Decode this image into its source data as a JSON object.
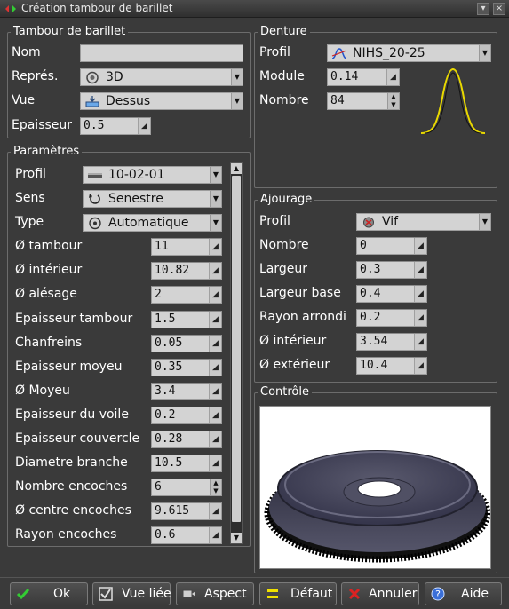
{
  "window": {
    "title": "Création tambour de barillet"
  },
  "tambour": {
    "title": "Tambour de barillet",
    "nom_label": "Nom",
    "nom_value": "",
    "repres_label": "Représ.",
    "repres_value": "3D",
    "vue_label": "Vue",
    "vue_value": "Dessus",
    "epaisseur_label": "Epaisseur",
    "epaisseur_value": "0.5"
  },
  "parametres": {
    "title": "Paramètres",
    "profil_label": "Profil",
    "profil_value": "10-02-01",
    "sens_label": "Sens",
    "sens_value": "Senestre",
    "type_label": "Type",
    "type_value": "Automatique",
    "rows": [
      {
        "label": "Ø tambour",
        "value": "11"
      },
      {
        "label": "Ø intérieur",
        "value": "10.82"
      },
      {
        "label": "Ø alésage",
        "value": "2"
      },
      {
        "label": "Epaisseur tambour",
        "value": "1.5"
      },
      {
        "label": "Chanfreins",
        "value": "0.05"
      },
      {
        "label": "Epaisseur moyeu",
        "value": "0.35"
      },
      {
        "label": "Ø Moyeu",
        "value": "3.4"
      },
      {
        "label": "Epaisseur du voile",
        "value": "0.2"
      },
      {
        "label": "Epaisseur couvercle",
        "value": "0.28"
      },
      {
        "label": "Diametre branche",
        "value": "10.5"
      },
      {
        "label": "Nombre encoches",
        "value": "6"
      },
      {
        "label": "Ø centre encoches",
        "value": "9.615"
      },
      {
        "label": "Rayon encoches",
        "value": "0.6"
      }
    ]
  },
  "denture": {
    "title": "Denture",
    "profil_label": "Profil",
    "profil_value": "NIHS_20-25",
    "module_label": "Module",
    "module_value": "0.14",
    "nombre_label": "Nombre",
    "nombre_value": "84"
  },
  "ajourage": {
    "title": "Ajourage",
    "profil_label": "Profil",
    "profil_value": "Vif",
    "rows": [
      {
        "label": "Nombre",
        "value": "0"
      },
      {
        "label": "Largeur",
        "value": "0.3"
      },
      {
        "label": "Largeur base",
        "value": "0.4"
      },
      {
        "label": "Rayon arrondi",
        "value": "0.2"
      },
      {
        "label": "Ø intérieur",
        "value": "3.54"
      },
      {
        "label": "Ø extérieur",
        "value": "10.4"
      }
    ]
  },
  "controle": {
    "title": "Contrôle"
  },
  "buttons": {
    "ok": "Ok",
    "vue_liee": "Vue liée",
    "aspect": "Aspect",
    "defaut": "Défaut",
    "annuler": "Annuler",
    "aide": "Aide"
  },
  "colors": {
    "accent_green": "#33cc33",
    "cancel_red": "#dd2222",
    "default_yellow": "#f0e000",
    "help_blue": "#3a6fd8",
    "gear_curve": "#e8d800"
  },
  "icons": {
    "repres": "3d-icon",
    "vue": "top-view-icon",
    "profil": "profile-icon",
    "sens": "rotation-icon",
    "type": "auto-icon",
    "denture_profil": "curve-icon",
    "ajourage_profil": "sharp-icon"
  }
}
